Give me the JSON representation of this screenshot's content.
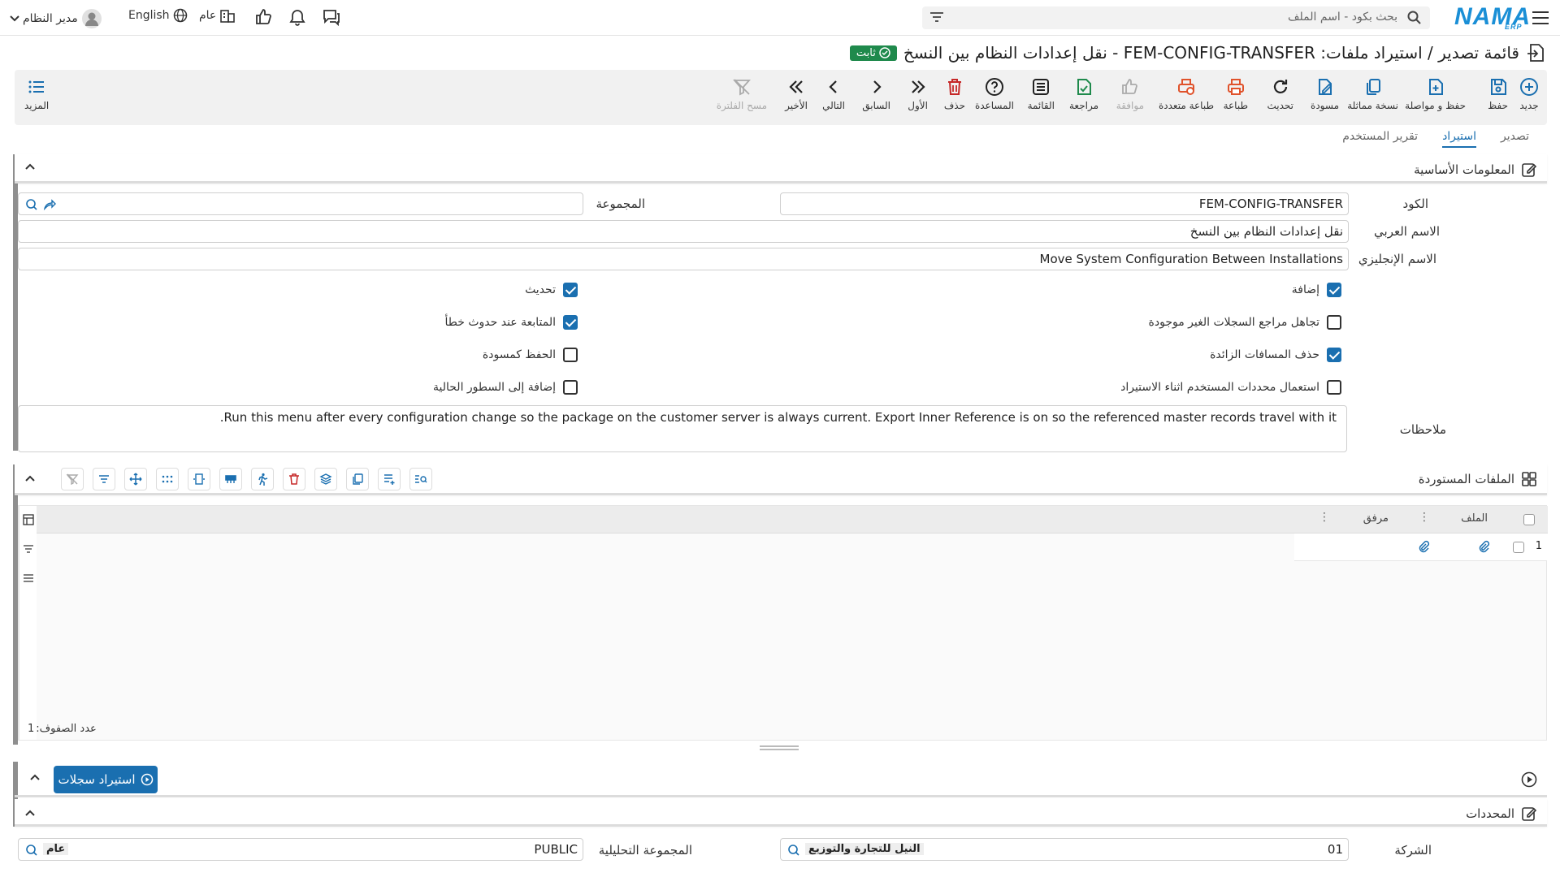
{
  "topbar": {
    "search_placeholder": "بحث بكود - اسم الملف",
    "logo": "NAMA",
    "logo_sub": "ERP",
    "user_name": "مدير النظام",
    "language": "English",
    "branch": "عام"
  },
  "header": {
    "title": "قائمة تصدير / استيراد ملفات: FEM-CONFIG-TRANSFER - نقل إعدادات النظام بين النسخ",
    "badge": "ثابت"
  },
  "toolbar": {
    "items": [
      {
        "label": "جديد",
        "icon": "plus-circle-icon"
      },
      {
        "label": "حفظ",
        "icon": "save-icon"
      },
      {
        "label": "حفظ و مواصلة",
        "icon": "save-continue-icon"
      },
      {
        "label": "نسخة مماثلة",
        "icon": "copy-icon"
      },
      {
        "label": "مسودة",
        "icon": "draft-icon"
      },
      {
        "label": "تحديث",
        "icon": "refresh-icon"
      },
      {
        "label": "طباعة",
        "icon": "print-icon"
      },
      {
        "label": "طباعة متعددة",
        "icon": "multi-print-icon"
      },
      {
        "label": "موافقة",
        "icon": "thumbs-up-icon"
      },
      {
        "label": "مراجعة",
        "icon": "review-icon"
      },
      {
        "label": "القائمة",
        "icon": "list-icon"
      },
      {
        "label": "المساعدة",
        "icon": "help-icon"
      },
      {
        "label": "حذف",
        "icon": "trash-icon"
      },
      {
        "label": "الأول",
        "icon": "first-icon"
      },
      {
        "label": "السابق",
        "icon": "prev-icon"
      },
      {
        "label": "التالي",
        "icon": "next-icon"
      },
      {
        "label": "الأخير",
        "icon": "last-icon"
      },
      {
        "label": "مسح الفلترة",
        "icon": "clear-filter-icon"
      }
    ],
    "more_label": "المزيد"
  },
  "tabs": [
    "تصدير",
    "استيراد",
    "تقرير المستخدم"
  ],
  "basic_info": {
    "title": "المعلومات الأساسية",
    "code_label": "الكود",
    "code_value": "FEM-CONFIG-TRANSFER",
    "group_label": "المجموعة",
    "group_value": "",
    "arabic_name_label": "الاسم العربي",
    "arabic_name_value": "نقل إعدادات النظام بين النسخ",
    "english_name_label": "الاسم الإنجليزي",
    "english_name_value": "Move System Configuration Between Installations",
    "checkboxes": {
      "add": {
        "label": "إضافة",
        "checked": true
      },
      "update": {
        "label": "تحديث",
        "checked": true
      },
      "ignore_missing": {
        "label": "تجاهل مراجع السجلات الغير موجودة",
        "checked": false
      },
      "continue_on_error": {
        "label": "المتابعة عند حدوث خطأ",
        "checked": true
      },
      "trim_spaces": {
        "label": "حذف المسافات الزائدة",
        "checked": true
      },
      "save_draft": {
        "label": "الحفظ كمسودة",
        "checked": false
      },
      "use_user_criteria": {
        "label": "استعمال محددات المستخدم اثناء الاستيراد",
        "checked": false
      },
      "append_lines": {
        "label": "إضافة إلى السطور الحالية",
        "checked": false
      }
    },
    "notes_label": "ملاحظات",
    "notes_value": "Run this menu after every configuration change so the package on the customer server is always current. Export Inner Reference is on so the referenced master records travel with it."
  },
  "imported_files": {
    "title": "الملفات المستوردة",
    "columns": [
      "الملف",
      "مرفق"
    ],
    "rows": [
      {
        "num": "1"
      }
    ],
    "row_count_label": "عدد الصفوف:",
    "row_count": "1"
  },
  "import_button": "استيراد سجلات",
  "criteria": {
    "title": "المحددات",
    "company_label": "الشركة",
    "company_code": "01",
    "company_name": "النيل للتجارة والتوزيع",
    "analytic_group_label": "المجموعة التحليلية",
    "analytic_group_code": "PUBLIC",
    "analytic_group_name": "عام"
  }
}
